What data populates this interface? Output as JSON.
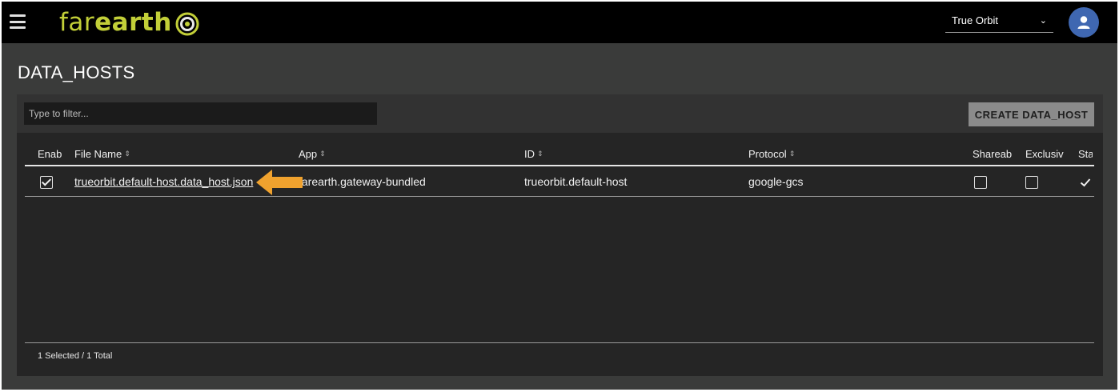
{
  "app": {
    "logo_text_light": "far",
    "logo_text_bold": "earth",
    "brand_color": "#c2cf38",
    "menu_icon": "hamburger-menu-icon",
    "avatar_icon": "user-icon"
  },
  "header": {
    "org_select": {
      "value": "True Orbit",
      "icon": "chevron-down-icon"
    }
  },
  "page": {
    "title": "DATA_HOSTS"
  },
  "toolbar": {
    "filter_placeholder": "Type to filter...",
    "create_label": "CREATE DATA_HOST"
  },
  "table": {
    "columns": [
      {
        "label": "Enab",
        "sortable": false
      },
      {
        "label": "File Name",
        "sortable": true
      },
      {
        "label": "App",
        "sortable": true
      },
      {
        "label": "ID",
        "sortable": true
      },
      {
        "label": "Protocol",
        "sortable": true
      },
      {
        "label": "Shareab",
        "sortable": false
      },
      {
        "label": "Exclusiv",
        "sortable": false
      },
      {
        "label": "Sta",
        "sortable": false
      }
    ],
    "rows": [
      {
        "enabled": true,
        "file_name": "trueorbit.default-host.data_host.json",
        "app": "farearth.gateway-bundled",
        "id": "trueorbit.default-host",
        "protocol": "google-gcs",
        "shareable": false,
        "exclusive": false,
        "status_icon": "checkmark-icon"
      }
    ],
    "footer": "1 Selected / 1 Total"
  },
  "annotation": {
    "arrow_color": "#f0a22e"
  }
}
